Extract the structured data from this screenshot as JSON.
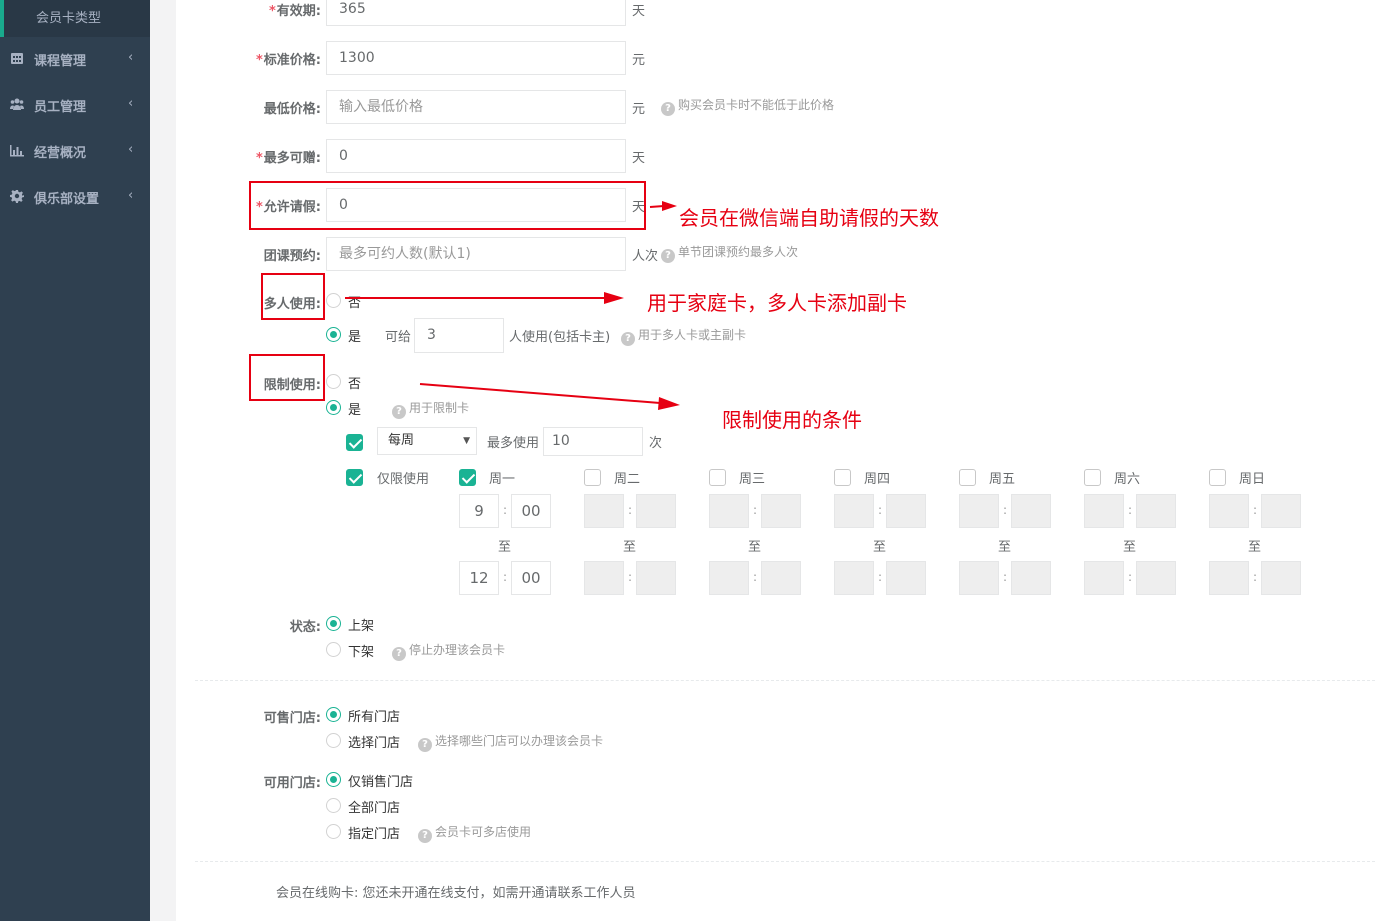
{
  "sidebar": {
    "sub_item": "会员卡类型",
    "items": [
      {
        "label": "课程管理",
        "icon": "calendar-icon"
      },
      {
        "label": "员工管理",
        "icon": "users-icon"
      },
      {
        "label": "经营概况",
        "icon": "bar-chart-icon"
      },
      {
        "label": "俱乐部设置",
        "icon": "gear-icon"
      }
    ],
    "chevron": "‹"
  },
  "form": {
    "required_mark": "*",
    "validity": {
      "label": "有效期:",
      "value": "365",
      "unit": "天"
    },
    "standard_price": {
      "label": "标准价格:",
      "value": "1300",
      "unit": "元"
    },
    "min_price": {
      "label": "最低价格:",
      "placeholder": "输入最低价格",
      "unit": "元",
      "help": "购买会员卡时不能低于此价格"
    },
    "max_gift": {
      "label": "最多可赠:",
      "value": "0",
      "unit": "天"
    },
    "leave": {
      "label": "允许请假:",
      "value": "0",
      "unit": "天"
    },
    "group_booking": {
      "label": "团课预约:",
      "placeholder": "最多可约人数(默认1)",
      "unit": "人次",
      "help": "单节团课预约最多人次"
    },
    "multi_user": {
      "label": "多人使用:",
      "no_label": "否",
      "yes_label": "是",
      "selected": "yes",
      "give_label": "可给",
      "give_value": "3",
      "give_unit": "人使用(包括卡主)",
      "help": "用于多人卡或主副卡"
    },
    "restrict": {
      "label": "限制使用:",
      "no_label": "否",
      "yes_label": "是",
      "selected": "yes",
      "help": "用于限制卡",
      "period_checked": true,
      "period_select": "每周",
      "max_use_label": "最多使用",
      "max_use_value": "10",
      "max_use_unit": "次",
      "only_checked": true,
      "only_label": "仅限使用",
      "to_label": "至",
      "colon": ":",
      "days": [
        {
          "label": "周一",
          "checked": true,
          "start_h": "9",
          "start_m": "00",
          "end_h": "12",
          "end_m": "00"
        },
        {
          "label": "周二",
          "checked": false
        },
        {
          "label": "周三",
          "checked": false
        },
        {
          "label": "周四",
          "checked": false
        },
        {
          "label": "周五",
          "checked": false
        },
        {
          "label": "周六",
          "checked": false
        },
        {
          "label": "周日",
          "checked": false
        }
      ]
    },
    "status": {
      "label": "状态:",
      "on_label": "上架",
      "off_label": "下架",
      "selected": "on",
      "help": "停止办理该会员卡"
    },
    "sale_stores": {
      "label": "可售门店:",
      "all_label": "所有门店",
      "select_label": "选择门店",
      "selected": "all",
      "help": "选择哪些门店可以办理该会员卡"
    },
    "use_stores": {
      "label": "可用门店:",
      "only_label": "仅销售门店",
      "all_label": "全部门店",
      "specific_label": "指定门店",
      "selected": "only",
      "help": "会员卡可多店使用"
    },
    "online_note": "会员在线购卡: 您还未开通在线支付，如需开通请联系工作人员"
  },
  "annotations": {
    "leave_note": "会员在微信端自助请假的天数",
    "multi_note": "用于家庭卡，多人卡添加副卡",
    "restrict_note": "限制使用的条件",
    "color": "#e60012"
  }
}
